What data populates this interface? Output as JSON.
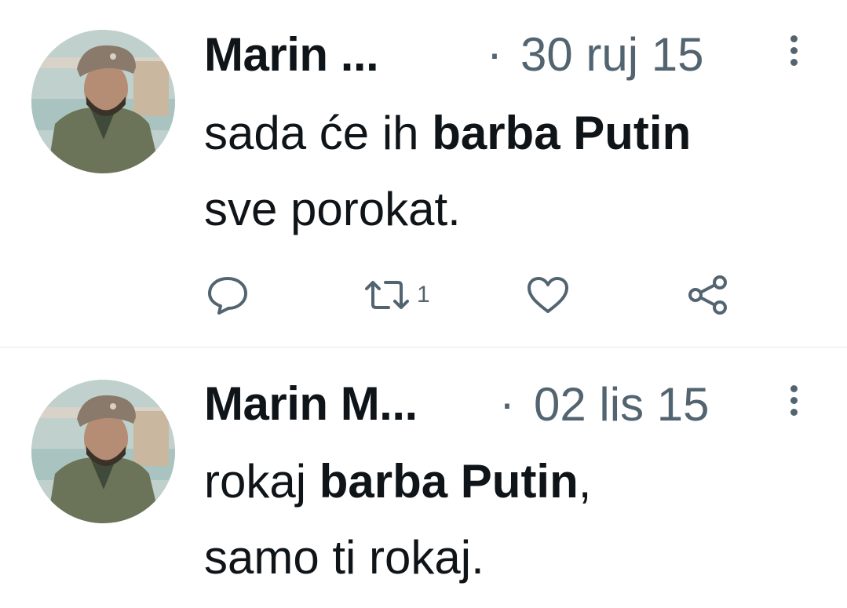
{
  "tweets": [
    {
      "author": "Marin ...",
      "separator": "·",
      "date": "30 ruj 15",
      "text_parts": [
        "sada će ih ",
        "barba Putin",
        "sve porokat."
      ],
      "actions": {
        "retweet_count": "1"
      }
    },
    {
      "author": "Marin M...",
      "separator": "·",
      "date": "02 lis 15",
      "text_parts": [
        "rokaj ",
        "barba Putin",
        ",",
        "samo ti rokaj."
      ]
    }
  ],
  "colors": {
    "text_primary": "#0f1419",
    "text_secondary": "#536471",
    "divider": "#e7e9ea",
    "background": "#ffffff"
  },
  "icons": [
    "reply-icon",
    "retweet-icon",
    "like-icon",
    "share-icon",
    "more-icon"
  ]
}
